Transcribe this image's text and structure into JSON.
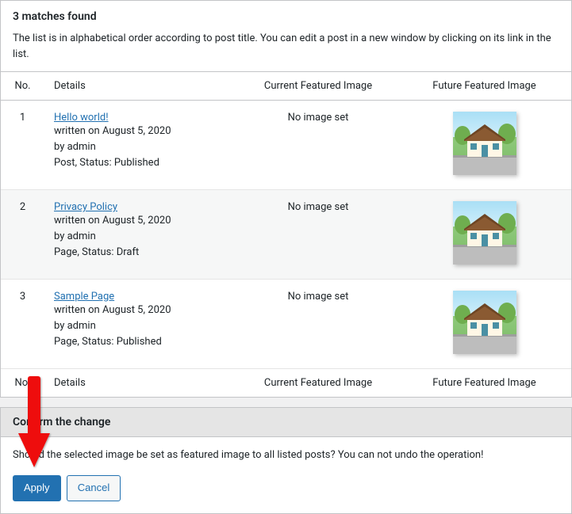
{
  "header": {
    "title": "3 matches found",
    "description": "The list is in alphabetical order according to post title. You can edit a post in a new window by clicking on its link in the list."
  },
  "columns": {
    "no": "No.",
    "details": "Details",
    "current": "Current Featured Image",
    "future": "Future Featured Image"
  },
  "noImageText": "No image set",
  "rows": [
    {
      "no": "1",
      "title": "Hello world!",
      "written": "written on August 5, 2020",
      "by": "by admin",
      "meta": "Post, Status: Published"
    },
    {
      "no": "2",
      "title": "Privacy Policy",
      "written": "written on August 5, 2020",
      "by": "by admin",
      "meta": "Page, Status: Draft"
    },
    {
      "no": "3",
      "title": "Sample Page",
      "written": "written on August 5, 2020",
      "by": "by admin",
      "meta": "Page, Status: Published"
    }
  ],
  "confirm": {
    "heading": "Confirm the change",
    "text": "Should the selected image be set as featured image to all listed posts? You can not undo the operation!",
    "apply": "Apply",
    "cancel": "Cancel"
  }
}
